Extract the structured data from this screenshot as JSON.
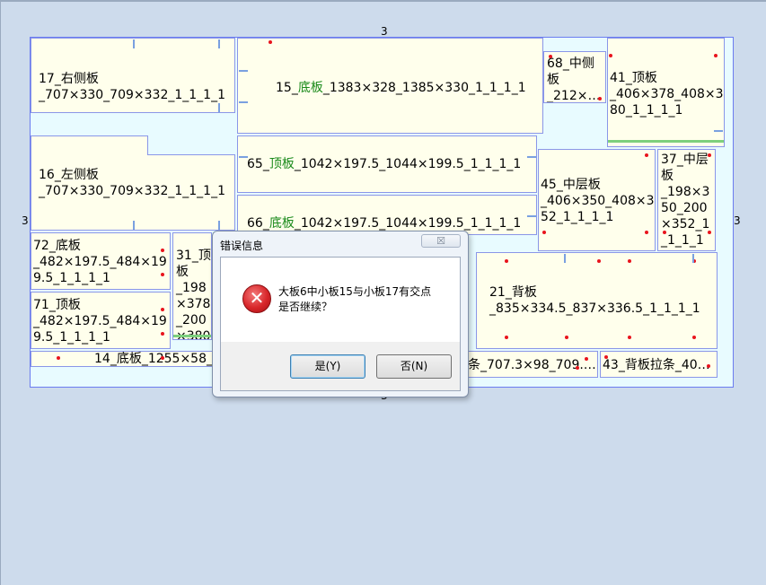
{
  "layout": {
    "dim_top": "3",
    "dim_bottom": "3",
    "dim_left": "3",
    "dim_right": "3"
  },
  "panels": {
    "p17": "17_右侧板\n_707×330_709×332_1_1_1_1",
    "p15_pre": "15_",
    "p15_green": "底板",
    "p15_post": "_1383×328_1385×330_1_1_1_1",
    "p68": "68_中侧板\n_212×…",
    "p41": "41_顶板\n_406×378_408×380_1_1_1_1",
    "p16": "16_左侧板\n_707×330_709×332_1_1_1_1",
    "p65_pre": "65_",
    "p65_green": "顶板",
    "p65_post": "_1042×197.5_1044×199.5_1_1_1_1",
    "p66_pre": "66_",
    "p66_green": "底板",
    "p66_post": "_1042×197.5_1044×199.5_1_1_1_1",
    "p45": "45_中层板\n_406×350_408×352_1_1_1_1",
    "p37": "37_中层板\n_198×350_200×352_1_1_1_1",
    "p72": "72_底板\n_482×197.5_484×199.5_1_1_1_1",
    "p71": "71_顶板\n_482×197.5_484×199.5_1_1_1_1",
    "p31": "31_顶板\n_198×378_200×380_1_1_1_1",
    "p21": "21_背板\n_835×334.5_837×336.5_1_1_1_1",
    "p14": "14_底板_1255×58_1257×60_1_1_1_1",
    "pstrip1": "条_707.3×98_709.…",
    "p43": "43_背板拉条_40…"
  },
  "dialog": {
    "title": "错误信息",
    "close_label": "☒",
    "message_line1": "大板6中小板15与小板17有交点",
    "message_line2": "是否继续？",
    "icon_glyph": "✕",
    "yes_label": "是(Y)",
    "no_label": "否(N)"
  },
  "colors": {
    "background": "#cddbec",
    "panel_fill": "#ffffec",
    "panel_border": "#8a96e8",
    "hole_dot": "#e8141d",
    "edge_green": "#7dd07d"
  }
}
